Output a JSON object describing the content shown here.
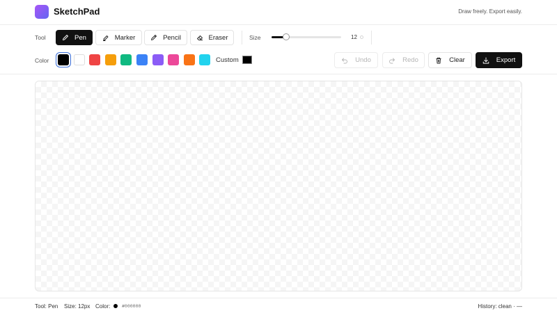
{
  "app": {
    "title": "SketchPad",
    "tagline": "Draw freely. Export easily."
  },
  "toolbar": {
    "tool_label": "Tool",
    "tools": [
      {
        "label": "Pen",
        "icon": "pen-icon",
        "active": true
      },
      {
        "label": "Marker",
        "icon": "marker-icon",
        "active": false
      },
      {
        "label": "Pencil",
        "icon": "pencil-icon",
        "active": false
      },
      {
        "label": "Eraser",
        "icon": "eraser-icon",
        "active": false
      }
    ],
    "size_label": "Size",
    "size": {
      "value": "12",
      "fraction": 0.21
    },
    "color_label": "Color",
    "swatches": [
      "#000000",
      "#ffffff",
      "#ef4444",
      "#f59e0b",
      "#10b981",
      "#3b82f6",
      "#8b5cf6",
      "#ec4899",
      "#f97316",
      "#22d3ee"
    ],
    "selected_color": "#000000",
    "custom_label": "Custom",
    "custom_color": "#000000",
    "actions": {
      "undo": "Undo",
      "redo": "Redo",
      "clear": "Clear",
      "export": "Export"
    }
  },
  "status": {
    "tool": "Tool: Pen",
    "size": "Size: 12px",
    "color_label": "Color:",
    "color_hex": "#000000",
    "history": "History: clean · —"
  }
}
